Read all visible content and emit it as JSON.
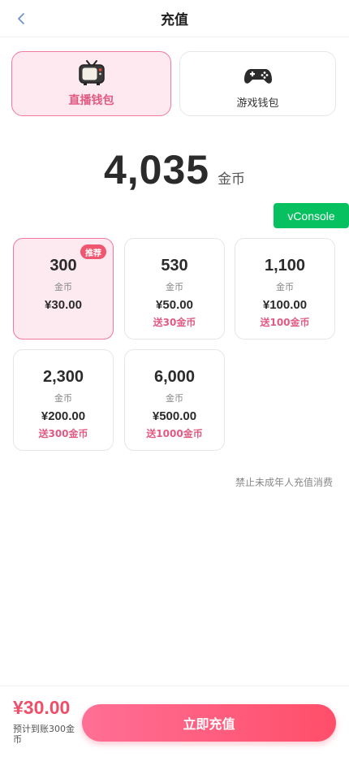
{
  "header": {
    "title": "充值"
  },
  "wallets": [
    {
      "label": "直播钱包",
      "icon": "tv-icon",
      "selected": true
    },
    {
      "label": "游戏钱包",
      "icon": "gamepad-icon",
      "selected": false
    }
  ],
  "balance": {
    "amount": "4,035",
    "unit": "金币"
  },
  "vconsole": {
    "label": "vConsole"
  },
  "packages": [
    {
      "coins": "300",
      "unit": "金币",
      "price": "¥30.00",
      "bonus": "",
      "badge": "推荐",
      "selected": true
    },
    {
      "coins": "530",
      "unit": "金币",
      "price": "¥50.00",
      "bonus": "送30金币"
    },
    {
      "coins": "1,100",
      "unit": "金币",
      "price": "¥100.00",
      "bonus": "送100金币"
    },
    {
      "coins": "2,300",
      "unit": "金币",
      "price": "¥200.00",
      "bonus": "送300金币"
    },
    {
      "coins": "6,000",
      "unit": "金币",
      "price": "¥500.00",
      "bonus": "送1000金币"
    }
  ],
  "notice": "禁止未成年人充值消费",
  "footer": {
    "price": "¥30.00",
    "expected": "预计到账300金币",
    "button_label": "立即充值"
  },
  "colors": {
    "accent": "#ef4f68",
    "pink_text": "#e05a83",
    "selected_bg": "#fdeaf0",
    "vconsole_green": "#07c160"
  }
}
